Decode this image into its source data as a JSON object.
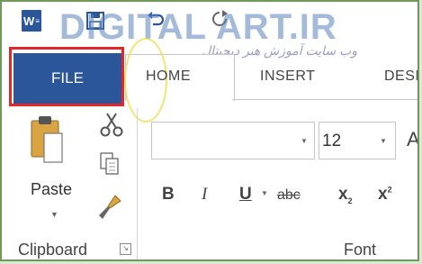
{
  "app": {
    "icon_letter": "W",
    "watermark": "DIGITAL ART.IR",
    "watermark_sub": "وب سایت آموزش هنر دیجیتال"
  },
  "tabs": [
    {
      "label": "FILE",
      "active": false,
      "highlighted": true
    },
    {
      "label": "HOME",
      "active": true
    },
    {
      "label": "INSERT",
      "active": false
    },
    {
      "label": "DESI",
      "active": false
    }
  ],
  "clipboard": {
    "paste_label": "Paste",
    "group_label": "Clipboard",
    "tools": [
      "paste-icon",
      "cut-icon",
      "copy-icon",
      "format-painter-icon"
    ]
  },
  "font": {
    "font_name": "",
    "font_size": "12",
    "grow_label": "A",
    "bold": "B",
    "italic": "I",
    "underline": "U",
    "strikethrough": "abc",
    "subscript": "x",
    "subscript_mark": "2",
    "superscript": "x",
    "superscript_mark": "2",
    "group_label": "Font"
  },
  "colors": {
    "accent": "#2b579a",
    "highlight": "#e0282a",
    "border": "#6f9a5a"
  }
}
